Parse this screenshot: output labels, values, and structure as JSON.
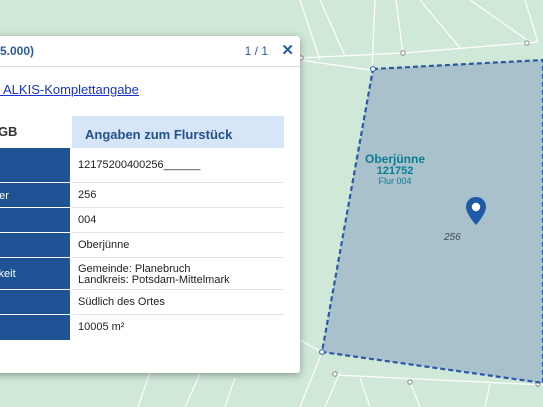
{
  "map": {
    "parcel_name": "Oberjünne",
    "parcel_code": "121752",
    "parcel_flur": "Flur 004",
    "parcel_number": "256",
    "colors": {
      "background": "#cfe8d8",
      "parcel_fill": "#a8c1cb",
      "parcel_outline": "#2c58a8",
      "pin": "#1e5aa8"
    }
  },
  "popup": {
    "title": "5.000)",
    "pager": "1 / 1",
    "close_icon": "close-icon",
    "link_text": "el ALKIS-Komplettangabe",
    "left_heading": "LGB",
    "heading": "Angaben zum Flurstück",
    "rows": [
      {
        "label": "",
        "value": "12175200400256______"
      },
      {
        "label": "mer",
        "value": "256"
      },
      {
        "label": "",
        "value": "004"
      },
      {
        "label": "",
        "value": "Oberjünne"
      },
      {
        "label": "igkeit",
        "value": "Gemeinde: Planebruch",
        "value2": "Landkreis: Potsdam-Mittelmark"
      },
      {
        "label": "",
        "value": "Südlich des Ortes"
      },
      {
        "label": "",
        "value": "10005 m²"
      }
    ]
  }
}
